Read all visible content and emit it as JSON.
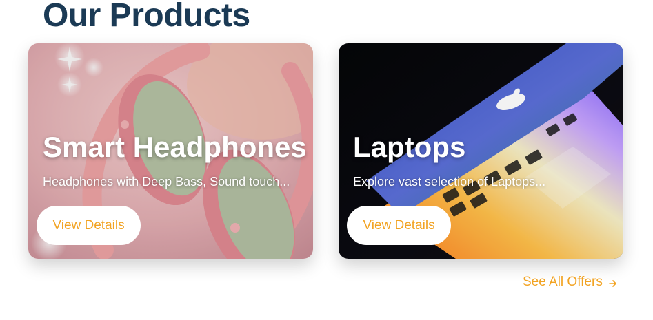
{
  "section": {
    "title": "Our Products"
  },
  "cards": [
    {
      "title": "Smart Headphones",
      "description": "Headphones with Deep Bass, Sound touch...",
      "button_label": "View Details",
      "image_icon": "headphones-image"
    },
    {
      "title": "Laptops",
      "description": "Explore vast selection of Laptops...",
      "button_label": "View Details",
      "image_icon": "laptop-image"
    }
  ],
  "see_all": {
    "label": "See All Offers",
    "icon": "arrow-right-icon"
  },
  "colors": {
    "title": "#1b3a55",
    "accent": "#f2a322",
    "card_text": "#ffffff"
  }
}
